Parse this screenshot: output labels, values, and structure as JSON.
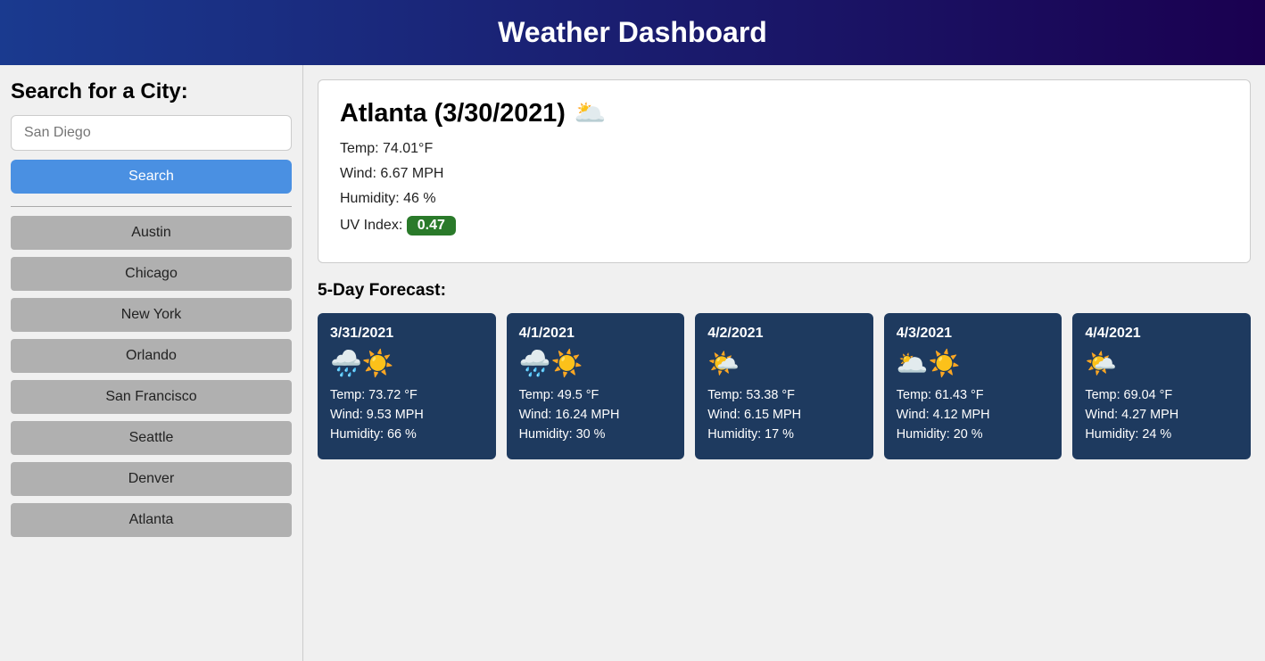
{
  "header": {
    "title": "Weather Dashboard"
  },
  "sidebar": {
    "search_label": "Search for a City:",
    "search_input_placeholder": "San Diego",
    "search_button_label": "Search",
    "cities": [
      "Austin",
      "Chicago",
      "New York",
      "Orlando",
      "San Francisco",
      "Seattle",
      "Denver",
      "Atlanta"
    ]
  },
  "current_weather": {
    "city_date": "Atlanta (3/30/2021)",
    "icon": "🌥️",
    "temp": "Temp: 74.01°F",
    "wind": "Wind: 6.67 MPH",
    "humidity": "Humidity: 46 %",
    "uv_label": "UV Index:",
    "uv_value": "0.47"
  },
  "forecast_section": {
    "title": "5-Day Forecast:",
    "days": [
      {
        "date": "3/31/2021",
        "icon": "🌧️☀️",
        "temp": "Temp: 73.72 °F",
        "wind": "Wind: 9.53 MPH",
        "humidity": "Humidity: 66 %"
      },
      {
        "date": "4/1/2021",
        "icon": "🌧️☀️",
        "temp": "Temp: 49.5 °F",
        "wind": "Wind: 16.24 MPH",
        "humidity": "Humidity: 30 %"
      },
      {
        "date": "4/2/2021",
        "icon": "🌤️",
        "temp": "Temp: 53.38 °F",
        "wind": "Wind: 6.15 MPH",
        "humidity": "Humidity: 17 %"
      },
      {
        "date": "4/3/2021",
        "icon": "🌥️☀️",
        "temp": "Temp: 61.43 °F",
        "wind": "Wind: 4.12 MPH",
        "humidity": "Humidity: 20 %"
      },
      {
        "date": "4/4/2021",
        "icon": "🌤️",
        "temp": "Temp: 69.04 °F",
        "wind": "Wind: 4.27 MPH",
        "humidity": "Humidity: 24 %"
      }
    ]
  }
}
